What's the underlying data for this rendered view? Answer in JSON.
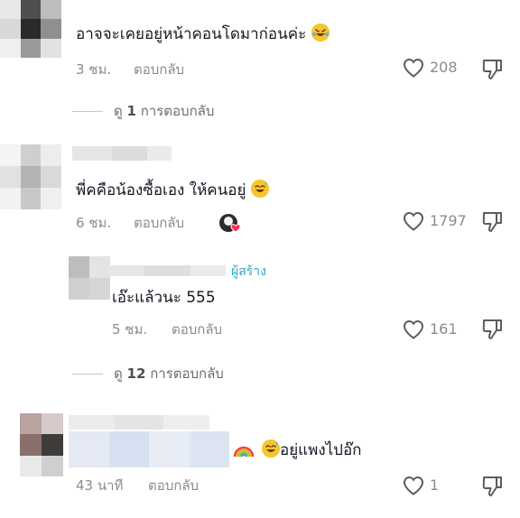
{
  "comments": [
    {
      "text": "อาจจะเคยอยู่หน้าคอนโดมาก่อนค่ะ",
      "time": "3 ชม.",
      "reply_label": "ตอบกลับ",
      "likes": "208",
      "view_replies": {
        "prefix": "ดู",
        "count": "1",
        "suffix": "การตอบกลับ"
      }
    },
    {
      "text": "พี่คคือน้องซื้อเอง ให้คนอยู่",
      "time": "6 ชม.",
      "reply_label": "ตอบกลับ",
      "likes": "1797",
      "reply": {
        "creator_label": "ผู้สร้าง",
        "text": "เอ๊ะแล้วนะ 555",
        "time": "5 ชม.",
        "reply_label": "ตอบกลับ",
        "likes": "161"
      },
      "view_replies": {
        "prefix": "ดู",
        "count": "12",
        "suffix": "การตอบกลับ"
      }
    },
    {
      "text": "อยู่แพงไปอ๊ก",
      "time": "43 นาที",
      "reply_label": "ตอบกลับ",
      "likes": "1"
    }
  ],
  "icons": {
    "like": "heart-outline-icon",
    "dislike": "thumbs-down-icon",
    "emoji_laugh": "rolling-laughing-emoji",
    "emoji_sweat": "sweat-smile-emoji",
    "rainbow": "rainbow-emoji"
  },
  "colors": {
    "text": "#161823",
    "secondary": "#8a8b91",
    "creator": "#35a3c8",
    "creator_badge_heart": "#fe2c55"
  }
}
